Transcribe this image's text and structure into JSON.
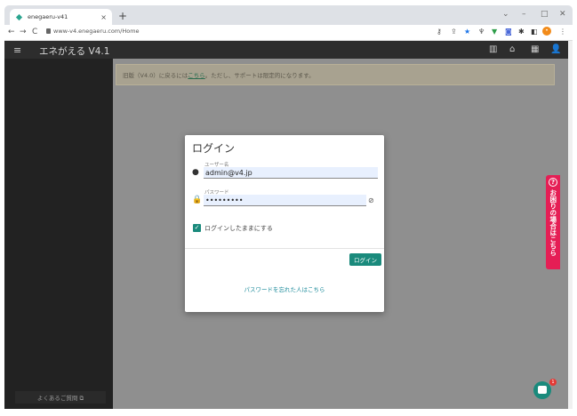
{
  "browser": {
    "tab_title": "enegaeru-v41",
    "url": "www-v4.enegaeru.com/Home"
  },
  "app": {
    "title": "エネがえる V4.1"
  },
  "banner": {
    "prefix": "旧版（V4.0）に戻るには",
    "link": "こちら",
    "suffix": "。ただし、サポートは限定的になります。"
  },
  "login": {
    "title": "ログイン",
    "username_label": "ユーザー名",
    "username_value": "admin@v4.jp",
    "password_label": "パスワード",
    "password_value": "•••••••••",
    "remember_label": "ログインしたままにする",
    "submit_label": "ログイン",
    "forgot_label": "パスワードを忘れた人はこちら"
  },
  "sidebar": {
    "faq_label": "よくあるご質問 ⧉"
  },
  "help_tab": {
    "label": "お困りの場合はこちら"
  },
  "chat": {
    "badge": "1"
  },
  "colors": {
    "accent": "#1a8a7c",
    "help": "#e51e55",
    "banner_bg": "#a8a290"
  }
}
